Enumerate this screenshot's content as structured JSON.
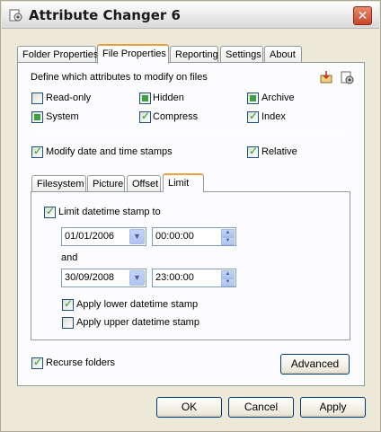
{
  "window": {
    "title": "Attribute Changer 6"
  },
  "tabs": [
    "Folder Properties",
    "File Properties",
    "Reporting",
    "Settings",
    "About"
  ],
  "active_tab": "File Properties",
  "attributes": {
    "heading": "Define which attributes to modify on files",
    "items": [
      {
        "label": "Read-only",
        "state": "unchecked"
      },
      {
        "label": "Hidden",
        "state": "partial"
      },
      {
        "label": "Archive",
        "state": "partial"
      },
      {
        "label": "System",
        "state": "partial"
      },
      {
        "label": "Compress",
        "state": "checked"
      },
      {
        "label": "Index",
        "state": "checked"
      }
    ]
  },
  "modify_dates": {
    "label": "Modify date and time stamps",
    "checked": true
  },
  "relative": {
    "label": "Relative",
    "checked": true
  },
  "subtabs": [
    "Filesystem",
    "Picture",
    "Offset",
    "Limit"
  ],
  "active_subtab": "Limit",
  "limit": {
    "enable_label": "Limit datetime stamp to",
    "enabled": true,
    "from_date": "01/01/2006",
    "from_time": "00:00:00",
    "and_label": "and",
    "to_date": "30/09/2008",
    "to_time": "23:00:00",
    "apply_lower_label": "Apply lower datetime stamp",
    "apply_lower": true,
    "apply_upper_label": "Apply upper datetime stamp",
    "apply_upper": false
  },
  "recurse": {
    "label": "Recurse folders",
    "checked": true
  },
  "buttons": {
    "advanced": "Advanced",
    "ok": "OK",
    "cancel": "Cancel",
    "apply": "Apply"
  },
  "colors": {
    "accent_tab": "#e8a23c",
    "check_green": "#21a121",
    "close_red": "#c8452a"
  }
}
